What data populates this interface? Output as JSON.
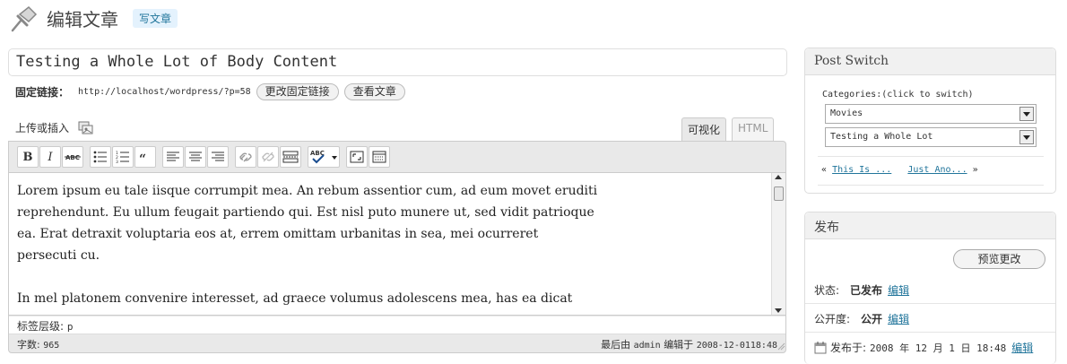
{
  "header": {
    "title": "编辑文章",
    "add_new": "写文章"
  },
  "post": {
    "title": "Testing a Whole Lot of Body Content",
    "permalink_label": "固定链接：",
    "permalink_url": "http://localhost/wordpress/?p=58",
    "change_permalink": "更改固定链接",
    "view_post": "查看文章"
  },
  "editor": {
    "upload_label": "上传或插入",
    "tab_visual": "可视化",
    "tab_html": "HTML",
    "toolbar": {
      "bold": "B",
      "italic": "I",
      "strikethrough": "ABC",
      "spellcheck": "ABC",
      "icons": [
        "bullet-list-icon",
        "numbered-list-icon",
        "blockquote-icon",
        "align-left-icon",
        "align-center-icon",
        "align-right-icon",
        "link-icon",
        "unlink-icon",
        "more-tag-icon",
        "spellcheck-icon",
        "fullscreen-icon",
        "kitchen-sink-icon"
      ]
    },
    "content_paragraphs": [
      "Lorem ipsum eu tale iisque corrumpit mea. An rebum assentior cum, ad eum movet eruditi reprehendunt. Eu ullum feugait partiendo qui. Est nisl puto munere ut, sed vidit patrioque ea. Erat detraxit voluptaria eos at, errem omittam urbanitas in sea, mei ocurreret persecuti cu.",
      "In mel platonem convenire interesset, ad graece volumus adolescens mea, has ea dicat"
    ],
    "path_label": "标签层级:",
    "path_value": "p",
    "word_count_label": "字数:",
    "word_count": "965",
    "last_edited_prefix": "最后由",
    "last_edited_user": "admin",
    "last_edited_mid": "编辑于",
    "last_edited_time": "2008-12-0118:48"
  },
  "post_switch": {
    "title": "Post Switch",
    "categories_label": "Categories:(click to switch)",
    "category_selected": "Movies",
    "post_selected": "Testing a Whole Lot",
    "prev_arrow": "«",
    "prev_link": "This Is ...",
    "next_link": "Just Ano...",
    "next_arrow": "»"
  },
  "publish": {
    "title": "发布",
    "preview_button": "预览更改",
    "status_label": "状态:",
    "status_value": "已发布",
    "visibility_label": "公开度:",
    "visibility_value": "公开",
    "edit_link": "编辑",
    "published_label": "发布于:",
    "published_date": "2008 年 12 月 1 日 18:48"
  },
  "colors": {
    "link": "#21759b",
    "panel_bg": "#f1f1f1",
    "border": "#dddddd"
  }
}
